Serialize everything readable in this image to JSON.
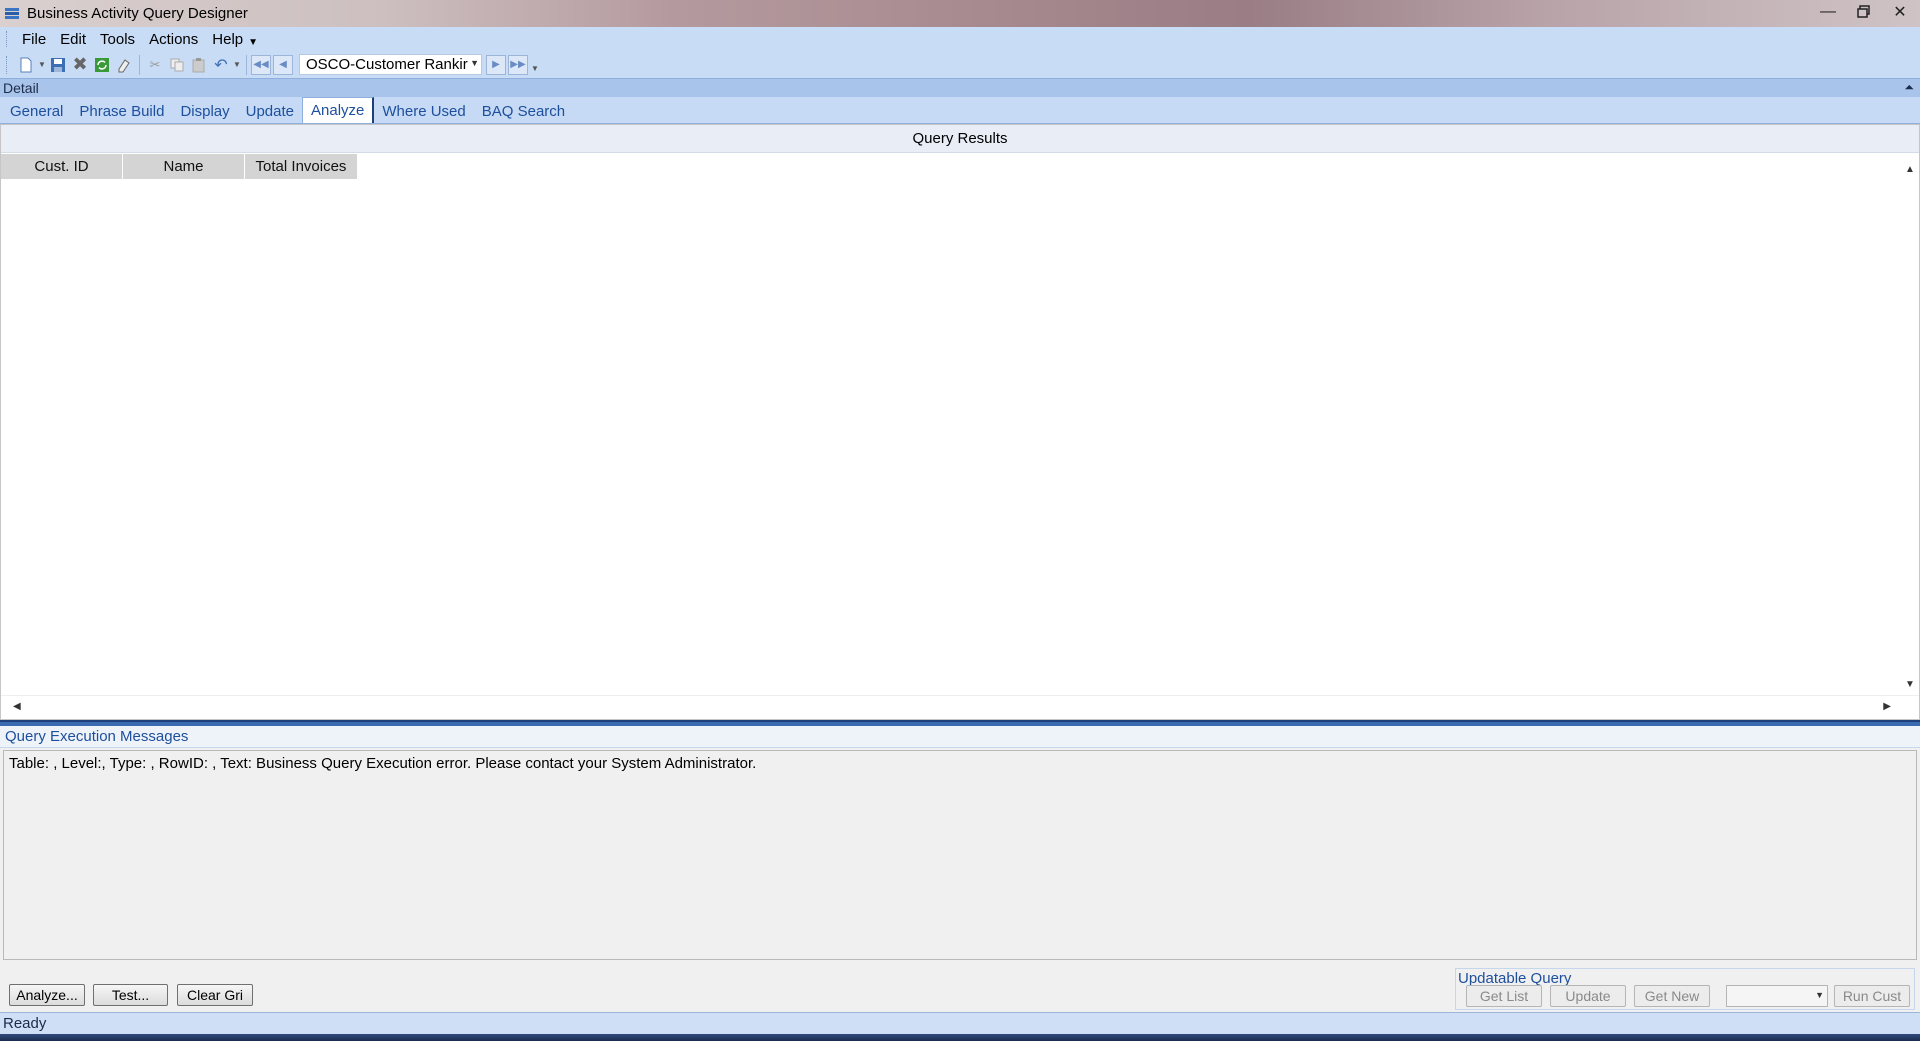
{
  "window": {
    "title": "Business Activity Query Designer"
  },
  "menu": {
    "items": [
      "File",
      "Edit",
      "Tools",
      "Actions",
      "Help"
    ]
  },
  "toolbar": {
    "record_selector": "OSCO-Customer Rankir"
  },
  "detail": {
    "label": "Detail"
  },
  "tabs": [
    {
      "label": "General"
    },
    {
      "label": "Phrase Build"
    },
    {
      "label": "Display"
    },
    {
      "label": "Update"
    },
    {
      "label": "Analyze"
    },
    {
      "label": "Where Used"
    },
    {
      "label": "BAQ Search"
    }
  ],
  "active_tab": "Analyze",
  "results": {
    "title": "Query Results",
    "columns": [
      "Cust. ID",
      "Name",
      "Total Invoices"
    ]
  },
  "messages": {
    "title": "Query Execution Messages",
    "text": "Table: , Level:, Type: , RowID: , Text: Business Query Execution error. Please contact your System Administrator."
  },
  "buttons": {
    "analyze": "Analyze...",
    "test": "Test...",
    "clear_grid": "Clear Gri"
  },
  "updatable_query": {
    "title": "Updatable Query",
    "get_list": "Get List",
    "update": "Update",
    "get_new": "Get New",
    "run_cust": "Run Cust"
  },
  "status": {
    "text": "Ready"
  },
  "colors": {
    "accent": "#1d4f9c",
    "toolbar_bg": "#c9dcf6",
    "splitter": "#3a6ab0"
  }
}
